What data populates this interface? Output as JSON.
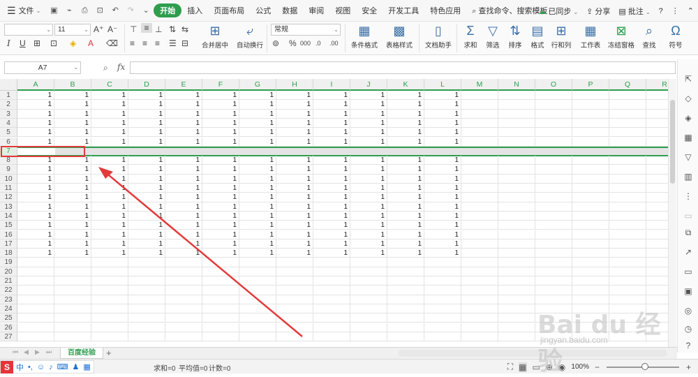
{
  "menubar": {
    "file_label": "文件",
    "tabs": [
      "开始",
      "插入",
      "页面布局",
      "公式",
      "数据",
      "审阅",
      "视图",
      "安全",
      "开发工具",
      "特色应用"
    ],
    "active_tab": "开始",
    "search_placeholder": "查找命令、搜索模板",
    "sync_label": "已同步",
    "share_label": "分享",
    "comment_label": "批注"
  },
  "ribbon": {
    "font_size": "11",
    "number_format": "常规",
    "buttons": {
      "merge": "合并居中",
      "wrap": "自动换行",
      "conditional_format": "条件格式",
      "table_style": "表格样式",
      "doc_assistant": "文档助手",
      "sum": "求和",
      "filter": "筛选",
      "sort": "排序",
      "format": "格式",
      "row_col": "行和列",
      "worksheet": "工作表",
      "freeze": "冻结窗格",
      "find": "查找",
      "symbol": "符号"
    }
  },
  "formula_bar": {
    "cell_ref": "A7",
    "fx_label": "fx",
    "value": ""
  },
  "sheet": {
    "columns": [
      "A",
      "B",
      "C",
      "D",
      "E",
      "F",
      "G",
      "H",
      "I",
      "J",
      "K",
      "L",
      "M",
      "N",
      "O",
      "P",
      "Q",
      "R"
    ],
    "row_numbers": [
      "1",
      "2",
      "3",
      "4",
      "5",
      "6",
      "7",
      "8",
      "9",
      "10",
      "11",
      "12",
      "13",
      "14",
      "15",
      "16",
      "17",
      "18",
      "19",
      "20",
      "21",
      "22",
      "23",
      "24",
      "25",
      "26",
      "27"
    ],
    "filled_rows": [
      "1",
      "2",
      "3",
      "4",
      "5",
      "6",
      "8",
      "9",
      "10",
      "11",
      "12",
      "13",
      "14",
      "15",
      "16",
      "17",
      "18"
    ],
    "selected_row": "7",
    "filled_value": "1"
  },
  "sheet_tabs": {
    "active": "百度经验",
    "add": "+"
  },
  "status": {
    "sum": "求和=0",
    "avg": "平均值=0",
    "count": "计数=0",
    "zoom": "100%",
    "ime_text": "中",
    "ime_glyph": "•,"
  },
  "watermark": {
    "brand": "Bai du 经验",
    "url": "jingyan.baidu.com"
  },
  "colors": {
    "accent": "#2e9e4e",
    "annotation": "#e23b3b",
    "header_bg": "#f0f0f0"
  }
}
